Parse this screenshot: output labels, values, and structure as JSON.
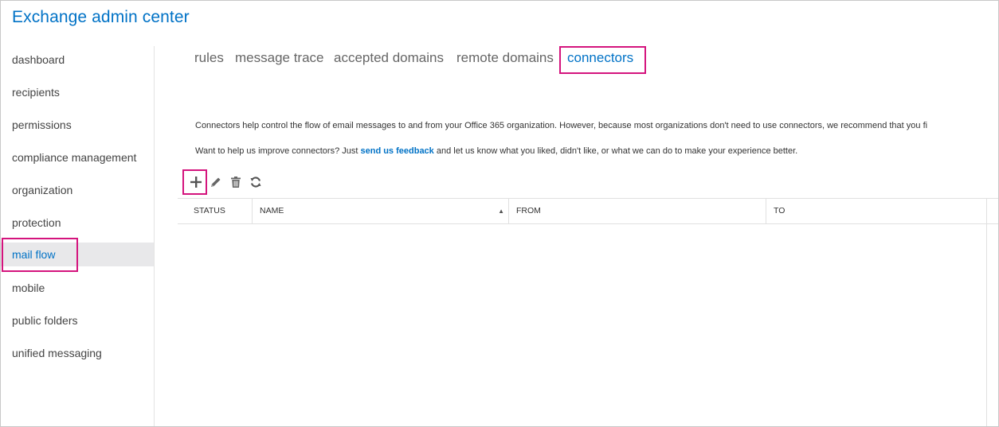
{
  "app": {
    "title": "Exchange admin center"
  },
  "sidebar": {
    "items": [
      {
        "label": "dashboard"
      },
      {
        "label": "recipients"
      },
      {
        "label": "permissions"
      },
      {
        "label": "compliance management"
      },
      {
        "label": "organization"
      },
      {
        "label": "protection"
      },
      {
        "label": "mail flow",
        "selected": true
      },
      {
        "label": "mobile"
      },
      {
        "label": "public folders"
      },
      {
        "label": "unified messaging"
      }
    ]
  },
  "tabs": [
    {
      "label": "rules"
    },
    {
      "label": "message trace"
    },
    {
      "label": "accepted domains"
    },
    {
      "label": "remote domains"
    },
    {
      "label": "connectors",
      "active": true
    }
  ],
  "description": {
    "line1": "Connectors help control the flow of email messages to and from your Office 365 organization. However, because most organizations don't need to use connectors, we recommend that you fi",
    "line2_before": "Want to help us improve connectors? Just ",
    "line2_link": "send us feedback",
    "line2_after": " and let us know what you liked, didn't like, or what we can do to make your experience better."
  },
  "toolbar": {
    "buttons": [
      {
        "icon": "plus-icon",
        "tooltip": "New"
      },
      {
        "icon": "pencil-icon",
        "tooltip": "Edit"
      },
      {
        "icon": "trash-icon",
        "tooltip": "Delete"
      },
      {
        "icon": "refresh-icon",
        "tooltip": "Refresh"
      }
    ]
  },
  "table": {
    "columns": [
      {
        "label": "STATUS"
      },
      {
        "label": "NAME",
        "sorted": "ascending"
      },
      {
        "label": "FROM"
      },
      {
        "label": "TO"
      }
    ],
    "rows": []
  },
  "colors": {
    "accent": "#0072c6",
    "highlight": "#d4147d",
    "selected_bg": "#e8e8ea"
  }
}
